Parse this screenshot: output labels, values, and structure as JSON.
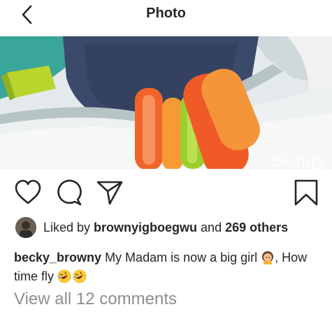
{
  "header": {
    "title": "Photo",
    "back_icon": "chevron-left-icon"
  },
  "photo": {
    "watermark": "Beauty"
  },
  "actions": {
    "icons": [
      "heart-icon",
      "comment-icon",
      "send-icon",
      "bookmark-icon"
    ]
  },
  "likes": {
    "prefix": "Liked by ",
    "user": "brownyigboegwu",
    "middle": " and ",
    "count_text": "269 others"
  },
  "caption": {
    "username": "becky_browny",
    "text": " My Madam is now a big girl ",
    "text2": ", How time fly ",
    "emoji_1": "girl-emoji",
    "emoji_2": "rofl-emoji"
  },
  "comments": {
    "link": "View all 12 comments"
  },
  "colors": {
    "text": "#262626",
    "muted": "#8e8e8e",
    "ring_orange": "#f0642a",
    "ring_green": "#9ccf2e"
  }
}
